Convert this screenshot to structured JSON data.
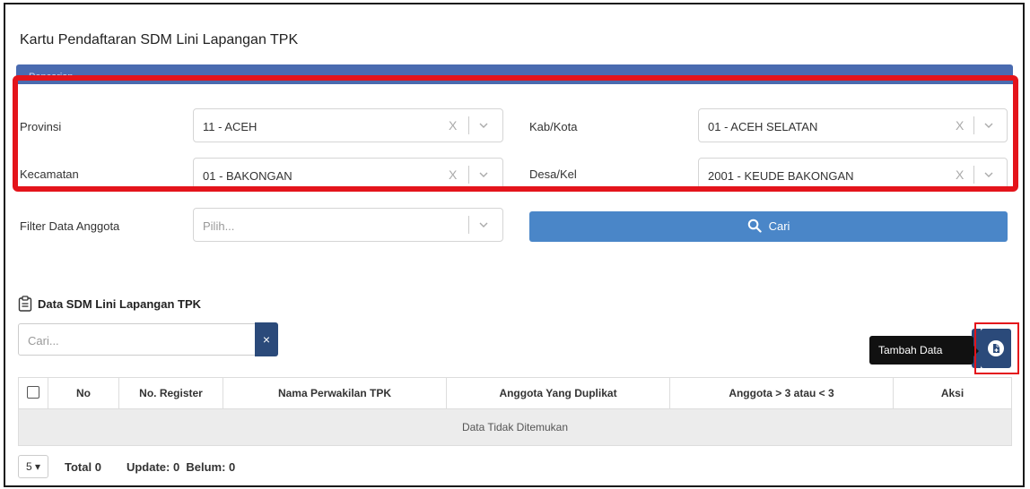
{
  "page": {
    "title": "Kartu Pendaftaran SDM Lini Lapangan TPK"
  },
  "panel": {
    "header": "Pencarian"
  },
  "filters": {
    "provinsi": {
      "label": "Provinsi",
      "value": "11 - ACEH"
    },
    "kabkota": {
      "label": "Kab/Kota",
      "value": "01 - ACEH SELATAN"
    },
    "kecamatan": {
      "label": "Kecamatan",
      "value": "01 - BAKONGAN"
    },
    "desakel": {
      "label": "Desa/Kel",
      "value": "2001 - KEUDE BAKONGAN"
    },
    "anggota": {
      "label": "Filter Data Anggota",
      "placeholder": "Pilih..."
    },
    "clear_glyph": "X"
  },
  "search_button": {
    "label": "Cari"
  },
  "section": {
    "title": "Data SDM Lini Lapangan TPK"
  },
  "table_search": {
    "placeholder": "Cari...",
    "clear_glyph": "×"
  },
  "tooltip": {
    "text": "Tambah Data Baru"
  },
  "table": {
    "columns": [
      "No",
      "No. Register",
      "Nama Perwakilan TPK",
      "Anggota Yang Duplikat",
      "Anggota > 3 atau < 3",
      "Aksi"
    ],
    "empty_message": "Data Tidak Ditemukan"
  },
  "footer": {
    "page_size": "5 ▾",
    "total": "Total 0",
    "status": "Update: 0  Belum: 0"
  },
  "colors": {
    "accent": "#4a86c8",
    "dark": "#2b4a7a",
    "highlight": "#e4141b"
  },
  "icons": {
    "search": "search-icon",
    "clipboard": "clipboard-icon",
    "add": "add-document-icon",
    "chevron": "chevron-down-icon"
  }
}
